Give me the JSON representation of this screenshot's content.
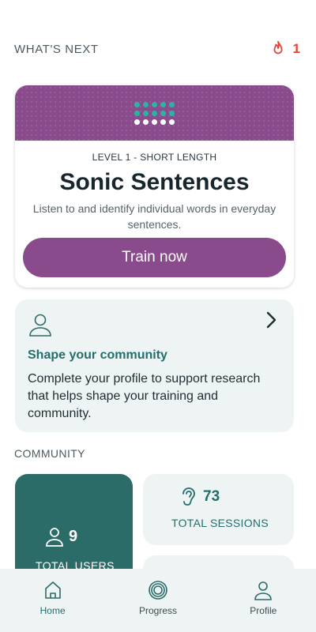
{
  "header": {
    "title": "WHAT'S NEXT",
    "streak_count": "1",
    "streak_icon": "flame-icon"
  },
  "next_card": {
    "level": "LEVEL 1 - SHORT LENGTH",
    "title": "Sonic Sentences",
    "description": "Listen to and identify individual words in everyday sentences.",
    "button_label": "Train now",
    "accent_color": "#8a4b8c"
  },
  "community_card": {
    "icon": "person-icon",
    "title": "Shape your community",
    "text": "Complete your profile to support research that helps shape your training and community."
  },
  "community_section": {
    "label": "COMMUNITY"
  },
  "stats": {
    "users": {
      "value": "9",
      "label": "TOTAL USERS",
      "icon": "person-icon"
    },
    "sessions": {
      "value": "73",
      "label": "TOTAL SESSIONS",
      "icon": "ear-icon"
    }
  },
  "nav": {
    "items": [
      {
        "label": "Home",
        "icon": "home-icon",
        "active": true
      },
      {
        "label": "Progress",
        "icon": "progress-icon",
        "active": false
      },
      {
        "label": "Profile",
        "icon": "profile-icon",
        "active": false
      }
    ]
  },
  "colors": {
    "teal": "#2b6b68",
    "purple": "#8a4b8c",
    "flame": "#e2463a",
    "tile_bg": "#eef4f4"
  }
}
